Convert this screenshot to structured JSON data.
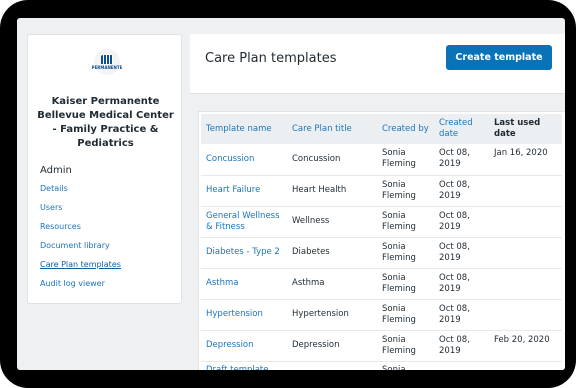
{
  "sidebar": {
    "logo_text": "PERMANENTE",
    "org_name": "Kaiser Permanente Bellevue Medical Center - Family Practice & Pediatrics",
    "admin_heading": "Admin",
    "nav": [
      {
        "label": "Details"
      },
      {
        "label": "Users"
      },
      {
        "label": "Resources"
      },
      {
        "label": "Document library"
      },
      {
        "label": "Care Plan templates"
      },
      {
        "label": "Audit log viewer"
      }
    ]
  },
  "header": {
    "title": "Care Plan templates",
    "create_button": "Create template"
  },
  "table": {
    "columns": [
      "Template name",
      "Care Plan title",
      "Created by",
      "Created date",
      "Last used date"
    ],
    "rows": [
      {
        "name": "Concussion",
        "title": "Concussion",
        "created_by": "Sonia Fleming",
        "created": "Oct 08, 2019",
        "last_used": "Jan 16, 2020"
      },
      {
        "name": "Heart Failure",
        "title": "Heart Health",
        "created_by": "Sonia Fleming",
        "created": "Oct 08, 2019",
        "last_used": ""
      },
      {
        "name": "General Wellness & Fitness",
        "title": "Wellness",
        "created_by": "Sonia Fleming",
        "created": "Oct 08, 2019",
        "last_used": ""
      },
      {
        "name": "Diabetes - Type 2",
        "title": "Diabetes",
        "created_by": "Sonia Fleming",
        "created": "Oct 08, 2019",
        "last_used": ""
      },
      {
        "name": "Asthma",
        "title": "Asthma",
        "created_by": "Sonia Fleming",
        "created": "Oct 08, 2019",
        "last_used": ""
      },
      {
        "name": "Hypertension",
        "title": "Hypertension",
        "created_by": "Sonia Fleming",
        "created": "Oct 08, 2019",
        "last_used": ""
      },
      {
        "name": "Depression",
        "title": "Depression",
        "created_by": "Sonia Fleming",
        "created": "Oct 08, 2019",
        "last_used": "Feb 20, 2020"
      },
      {
        "name": "Draft template",
        "title": "",
        "created_by": "Sonia",
        "created": "",
        "last_used": ""
      }
    ]
  }
}
